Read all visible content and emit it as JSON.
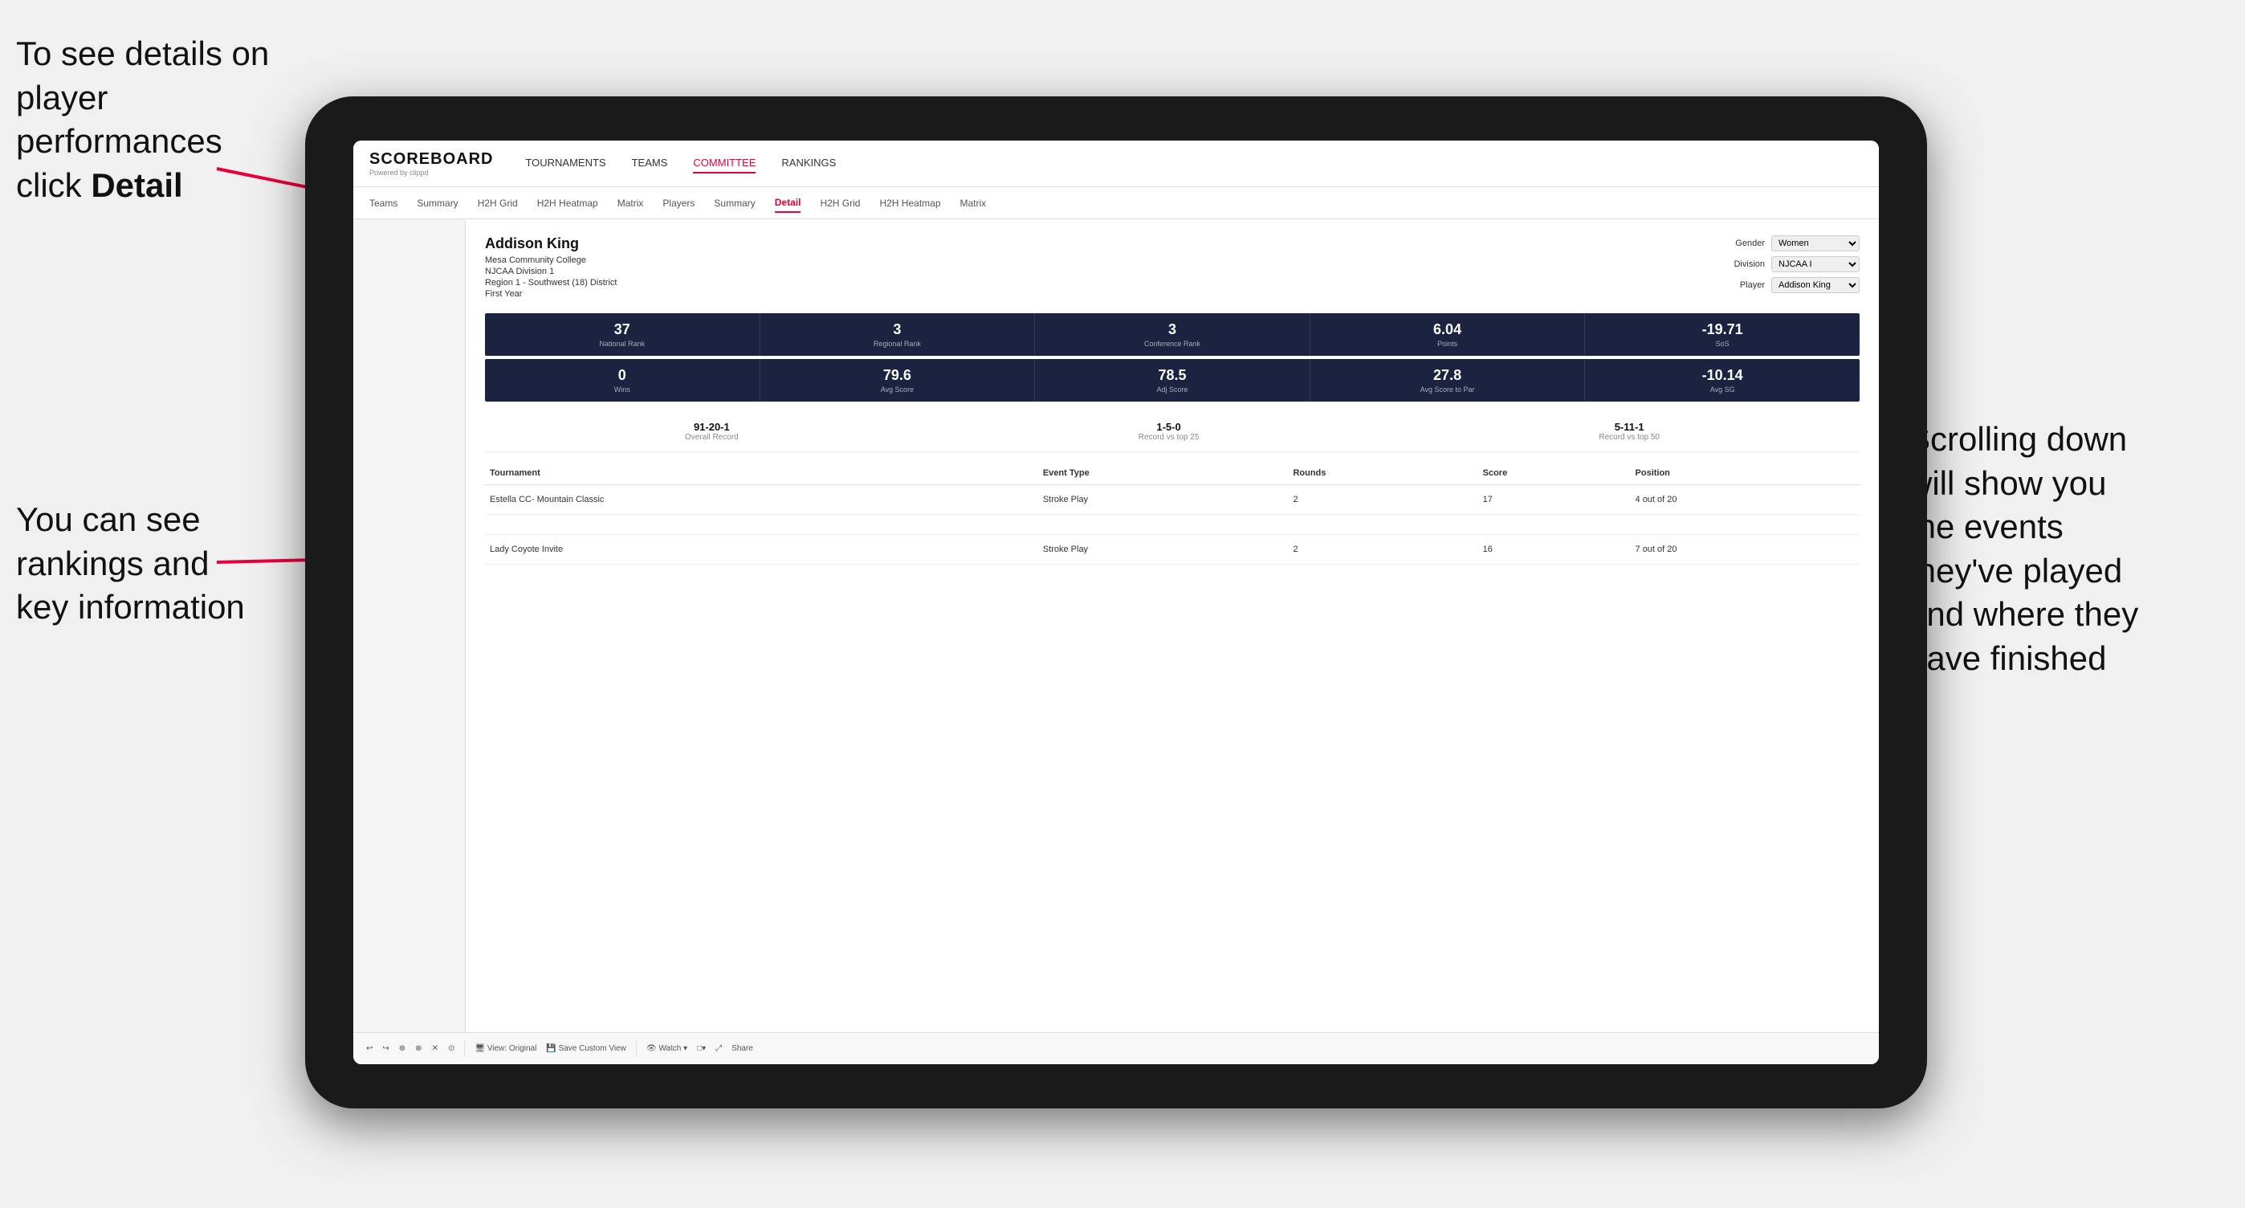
{
  "annotations": {
    "topLeft": "To see details on player performances click ",
    "topLeftBold": "Detail",
    "bottomLeft1": "You can see",
    "bottomLeft2": "rankings and",
    "bottomLeft3": "key information",
    "right1": "Scrolling down",
    "right2": "will show you",
    "right3": "the events",
    "right4": "they've played",
    "right5": "and where they",
    "right6": "have finished"
  },
  "topNav": {
    "logoTitle": "SCOREBOARD",
    "logoSubtitle": "Powered by clippd",
    "items": [
      "TOURNAMENTS",
      "TEAMS",
      "COMMITTEE",
      "RANKINGS"
    ]
  },
  "subNav": {
    "items": [
      "Teams",
      "Summary",
      "H2H Grid",
      "H2H Heatmap",
      "Matrix",
      "Players",
      "Summary",
      "Detail",
      "H2H Grid",
      "H2H Heatmap",
      "Matrix"
    ]
  },
  "sidebar": {
    "items": []
  },
  "player": {
    "name": "Addison King",
    "college": "Mesa Community College",
    "division": "NJCAA Division 1",
    "region": "Region 1 - Southwest (18) District",
    "year": "First Year",
    "genderLabel": "Gender",
    "genderValue": "Women",
    "divisionLabel": "Division",
    "divisionValue": "NJCAA I",
    "playerLabel": "Player",
    "playerValue": "Addison King"
  },
  "stats1": {
    "cells": [
      {
        "value": "37",
        "label": "National Rank"
      },
      {
        "value": "3",
        "label": "Regional Rank"
      },
      {
        "value": "3",
        "label": "Conference Rank"
      },
      {
        "value": "6.04",
        "label": "Points"
      },
      {
        "value": "-19.71",
        "label": "SoS"
      }
    ]
  },
  "stats2": {
    "cells": [
      {
        "value": "0",
        "label": "Wins"
      },
      {
        "value": "79.6",
        "label": "Avg Score"
      },
      {
        "value": "78.5",
        "label": "Adj Score"
      },
      {
        "value": "27.8",
        "label": "Avg Score to Par"
      },
      {
        "value": "-10.14",
        "label": "Avg SG"
      }
    ]
  },
  "records": [
    {
      "value": "91-20-1",
      "label": "Overall Record"
    },
    {
      "value": "1-5-0",
      "label": "Record vs top 25"
    },
    {
      "value": "5-11-1",
      "label": "Record vs top 50"
    }
  ],
  "tableHeaders": [
    "Tournament",
    "Event Type",
    "Rounds",
    "Score",
    "Position"
  ],
  "tableRows": [
    {
      "tournament": "Estella CC- Mountain Classic",
      "eventType": "Stroke Play",
      "rounds": "2",
      "score": "17",
      "position": "4 out of 20"
    },
    {
      "tournament": "",
      "eventType": "",
      "rounds": "",
      "score": "",
      "position": ""
    },
    {
      "tournament": "Lady Coyote Invite",
      "eventType": "Stroke Play",
      "rounds": "2",
      "score": "16",
      "position": "7 out of 20"
    }
  ],
  "toolbar": {
    "buttons": [
      "↩",
      "↪",
      "⊕",
      "⊗",
      "✕",
      "⊙",
      "View: Original",
      "Save Custom View",
      "Watch ▾",
      "□▾",
      "⤢",
      "Share"
    ]
  }
}
